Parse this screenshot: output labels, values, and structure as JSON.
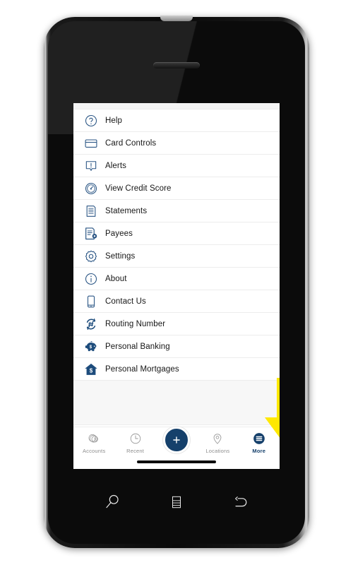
{
  "device": {
    "type": "smartphone-mockup",
    "earpiece": "speaker-grille",
    "hardware_keys": [
      {
        "name": "search-key",
        "icon": "magnifier-icon"
      },
      {
        "name": "menu-key",
        "icon": "list-menu-icon"
      },
      {
        "name": "back-key",
        "icon": "back-arrow-icon"
      }
    ]
  },
  "colors": {
    "brand_navy": "#15406b",
    "icon_navy": "#2b5685",
    "callout_yellow": "#ffe800",
    "text_dark": "#161616",
    "tab_inactive": "#8d8d8d",
    "list_divider": "#ececec",
    "filler_gray": "#f7f7f7"
  },
  "screen": {
    "menu": {
      "items": [
        {
          "label": "Help",
          "icon": "question-circle-icon"
        },
        {
          "label": "Card Controls",
          "icon": "credit-card-icon"
        },
        {
          "label": "Alerts",
          "icon": "alert-bubble-icon"
        },
        {
          "label": "View Credit Score",
          "icon": "speedometer-gauge-icon"
        },
        {
          "label": "Statements",
          "icon": "document-lines-icon"
        },
        {
          "label": "Payees",
          "icon": "document-gear-icon"
        },
        {
          "label": "Settings",
          "icon": "gear-icon"
        },
        {
          "label": "About",
          "icon": "info-circle-icon"
        },
        {
          "label": "Contact Us",
          "icon": "mobile-phone-icon"
        },
        {
          "label": "Routing Number",
          "icon": "hash-refresh-icon"
        },
        {
          "label": "Personal Banking",
          "icon": "piggy-bank-icon"
        },
        {
          "label": "Personal Mortgages",
          "icon": "house-dollar-icon"
        }
      ]
    },
    "tab_bar": {
      "tabs": [
        {
          "label": "Accounts",
          "icon": "coins-dollar-icon",
          "active": false
        },
        {
          "label": "Recent",
          "icon": "clock-icon",
          "active": false
        },
        {
          "label": "Locations",
          "icon": "map-pin-icon",
          "active": false
        },
        {
          "label": "More",
          "icon": "hamburger-circle-icon",
          "active": true
        }
      ],
      "center_action": {
        "label": "+",
        "icon": "plus-icon"
      }
    }
  },
  "annotation": {
    "callout": {
      "shape": "down-arrow",
      "points_at": "More",
      "color": "#ffe800"
    }
  }
}
